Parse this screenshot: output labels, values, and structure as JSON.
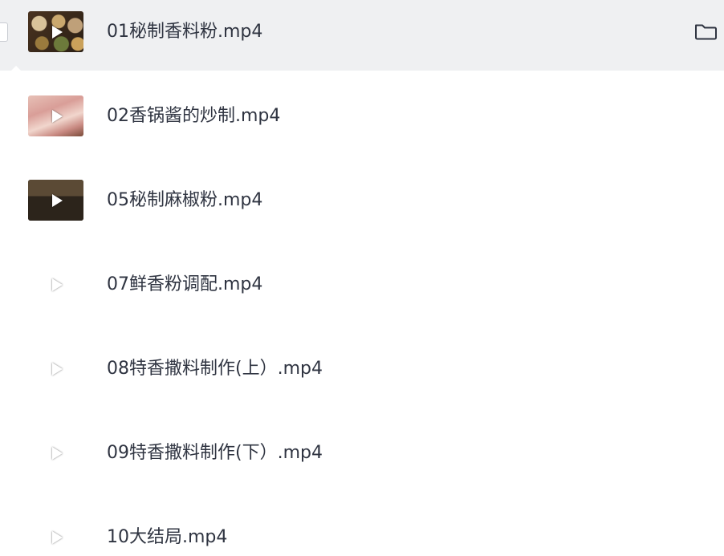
{
  "files": [
    {
      "name": "01秘制香料粉.mp4",
      "selected": true,
      "thumb": "video-thumbnail",
      "play_icon": "play-icon"
    },
    {
      "name": "02香锅酱的炒制.mp4",
      "selected": false,
      "thumb": "video-thumbnail",
      "play_icon": "play-icon"
    },
    {
      "name": "05秘制麻椒粉.mp4",
      "selected": false,
      "thumb": "video-thumbnail",
      "play_icon": "play-icon"
    },
    {
      "name": "07鲜香粉调配.mp4",
      "selected": false,
      "thumb": "video-thumbnail",
      "play_icon": "play-icon"
    },
    {
      "name": "08特香撒料制作(上）.mp4",
      "selected": false,
      "thumb": "video-thumbnail",
      "play_icon": "play-icon"
    },
    {
      "name": "09特香撒料制作(下）.mp4",
      "selected": false,
      "thumb": "video-thumbnail",
      "play_icon": "play-icon"
    },
    {
      "name": "10大结局.mp4",
      "selected": false,
      "thumb": "video-thumbnail",
      "play_icon": "play-icon"
    }
  ],
  "actions": {
    "open_folder_icon": "folder-icon"
  },
  "colors": {
    "selected_row_bg": "#eff0f2",
    "text": "#2f3441"
  }
}
